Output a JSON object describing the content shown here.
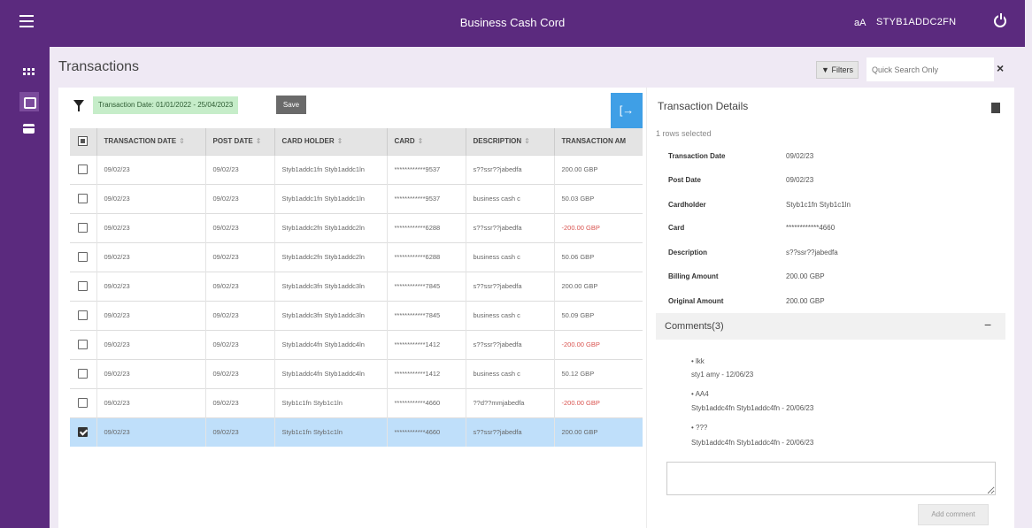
{
  "app": {
    "title": "Business Cash Cord",
    "font_size_label": "aA",
    "user": "STYB1ADDC2FN"
  },
  "page": {
    "title": "Transactions",
    "filters_label": "Filters",
    "search_placeholder": "Quick Search Only",
    "close_symbol": "×"
  },
  "toolbar": {
    "date_filter": "Transaction Date: 01/01/2022 - 25/04/2023",
    "save_label": "Save",
    "export_symbol": "[→"
  },
  "grid": {
    "headers": [
      "TRANSACTION DATE",
      "POST DATE",
      "CARD HOLDER",
      "CARD",
      "DESCRIPTION",
      "TRANSACTION AM"
    ],
    "sort_symbol": "⇕",
    "rows": [
      {
        "transaction_date": "09/02/23",
        "post_date": "09/02/23",
        "card_holder": "Styb1addc1fn Styb1addc1ln",
        "card": "************9537",
        "description": "s??ssr??jabedfa",
        "amount": "200.00 GBP",
        "negative": false,
        "selected": false
      },
      {
        "transaction_date": "09/02/23",
        "post_date": "09/02/23",
        "card_holder": "Styb1addc1fn Styb1addc1ln",
        "card": "************9537",
        "description": "business cash c",
        "amount": "50.03 GBP",
        "negative": false,
        "selected": false
      },
      {
        "transaction_date": "09/02/23",
        "post_date": "09/02/23",
        "card_holder": "Styb1addc2fn Styb1addc2ln",
        "card": "************6288",
        "description": "s??ssr??jabedfa",
        "amount": "-200.00 GBP",
        "negative": true,
        "selected": false
      },
      {
        "transaction_date": "09/02/23",
        "post_date": "09/02/23",
        "card_holder": "Styb1addc2fn Styb1addc2ln",
        "card": "************6288",
        "description": "business cash c",
        "amount": "50.06 GBP",
        "negative": false,
        "selected": false
      },
      {
        "transaction_date": "09/02/23",
        "post_date": "09/02/23",
        "card_holder": "Styb1addc3fn Styb1addc3ln",
        "card": "************7845",
        "description": "s??ssr??jabedfa",
        "amount": "200.00 GBP",
        "negative": false,
        "selected": false
      },
      {
        "transaction_date": "09/02/23",
        "post_date": "09/02/23",
        "card_holder": "Styb1addc3fn Styb1addc3ln",
        "card": "************7845",
        "description": "business cash c",
        "amount": "50.09 GBP",
        "negative": false,
        "selected": false
      },
      {
        "transaction_date": "09/02/23",
        "post_date": "09/02/23",
        "card_holder": "Styb1addc4fn Styb1addc4ln",
        "card": "************1412",
        "description": "s??ssr??jabedfa",
        "amount": "-200.00 GBP",
        "negative": true,
        "selected": false
      },
      {
        "transaction_date": "09/02/23",
        "post_date": "09/02/23",
        "card_holder": "Styb1addc4fn Styb1addc4ln",
        "card": "************1412",
        "description": "business cash c",
        "amount": "50.12 GBP",
        "negative": false,
        "selected": false
      },
      {
        "transaction_date": "09/02/23",
        "post_date": "09/02/23",
        "card_holder": "Styb1c1fn Styb1c1ln",
        "card": "************4660",
        "description": "??d??mmjabedfa",
        "amount": "-200.00 GBP",
        "negative": true,
        "selected": false
      },
      {
        "transaction_date": "09/02/23",
        "post_date": "09/02/23",
        "card_holder": "Styb1c1fn Styb1c1ln",
        "card": "************4660",
        "description": "s??ssr??jabedfa",
        "amount": "200.00 GBP",
        "negative": false,
        "selected": true
      }
    ]
  },
  "details": {
    "title": "Transaction Details",
    "rows_selected": "1 rows selected",
    "fields": [
      {
        "label": "Transaction Date",
        "value": "09/02/23"
      },
      {
        "label": "Post Date",
        "value": "09/02/23"
      },
      {
        "label": "Cardholder",
        "value": "Styb1c1fn Styb1c1ln"
      },
      {
        "label": "Card",
        "value": "************4660"
      },
      {
        "label": "Description",
        "value": "s??ssr??jabedfa"
      },
      {
        "label": "Billing Amount",
        "value": "200.00 GBP"
      },
      {
        "label": "Original Amount",
        "value": "200.00 GBP"
      }
    ],
    "comments_title": "Comments(3)",
    "collapse_symbol": "−",
    "comments": [
      {
        "text": "lkk",
        "meta": "sty1 amy - 12/06/23"
      },
      {
        "text": "AA4",
        "meta": "Styb1addc4fn Styb1addc4fn - 20/06/23"
      },
      {
        "text": "???",
        "meta": "Styb1addc4fn Styb1addc4fn - 20/06/23"
      }
    ],
    "add_comment_label": "Add comment"
  },
  "colors": {
    "brand_purple": "#5b2a7e",
    "selected_row": "#bfdffa",
    "negative_amount": "#d9534f",
    "date_chip": "#c6edc9",
    "export_button": "#3f9fe6"
  }
}
